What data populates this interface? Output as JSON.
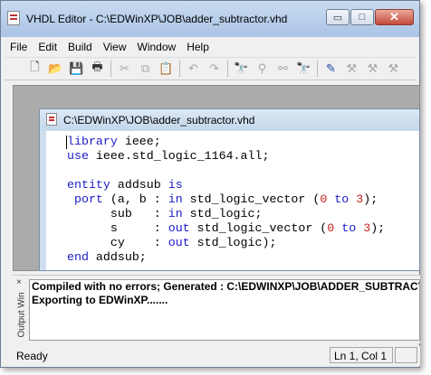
{
  "window": {
    "title": "VHDL Editor - C:\\EDWinXP\\JOB\\adder_subtractor.vhd",
    "minimize_glyph": "▭",
    "maximize_glyph": "□",
    "close_glyph": "✕"
  },
  "menu": [
    "File",
    "Edit",
    "Build",
    "View",
    "Window",
    "Help"
  ],
  "toolbar": {
    "icons": [
      {
        "name": "new-file-icon",
        "glyph": "🗋",
        "enabled": true
      },
      {
        "name": "open-folder-icon",
        "glyph": "📂",
        "enabled": true
      },
      {
        "name": "save-icon",
        "glyph": "💾",
        "enabled": true
      },
      {
        "name": "print-icon",
        "glyph": "🖶",
        "enabled": true
      },
      {
        "name": "cut-icon",
        "glyph": "✂",
        "enabled": false
      },
      {
        "name": "copy-icon",
        "glyph": "⧉",
        "enabled": false
      },
      {
        "name": "paste-icon",
        "glyph": "📋",
        "enabled": false
      },
      {
        "name": "undo-icon",
        "glyph": "↶",
        "enabled": false
      },
      {
        "name": "redo-icon",
        "glyph": "↷",
        "enabled": false
      },
      {
        "name": "find-icon",
        "glyph": "🔭",
        "enabled": true
      },
      {
        "name": "find-next-icon",
        "glyph": "⚲",
        "enabled": false
      },
      {
        "name": "replace-icon",
        "glyph": "⚯",
        "enabled": false
      },
      {
        "name": "find-red-icon",
        "glyph": "🔭",
        "enabled": true
      },
      {
        "name": "compile-icon",
        "glyph": "✎",
        "enabled": true
      },
      {
        "name": "build-icon",
        "glyph": "⚒",
        "enabled": false
      },
      {
        "name": "build-all-icon",
        "glyph": "⚒",
        "enabled": false
      },
      {
        "name": "stop-build-icon",
        "glyph": "⚒",
        "enabled": false
      }
    ]
  },
  "document": {
    "title": "C:\\EDWinXP\\JOB\\adder_subtractor.vhd"
  },
  "output": {
    "close_glyph": "×",
    "label": "Output Win",
    "lines": [
      "Compiled with no errors; Generated : C:\\EDWINXP\\JOB\\ADDER_SUBTRACTOR.EDW",
      "Exporting to EDWinXP......."
    ]
  },
  "status": {
    "ready": "Ready",
    "position": "Ln 1, Col 1"
  },
  "colors": {
    "keyword": "#1b1bc7",
    "number": "#c41e1e"
  }
}
